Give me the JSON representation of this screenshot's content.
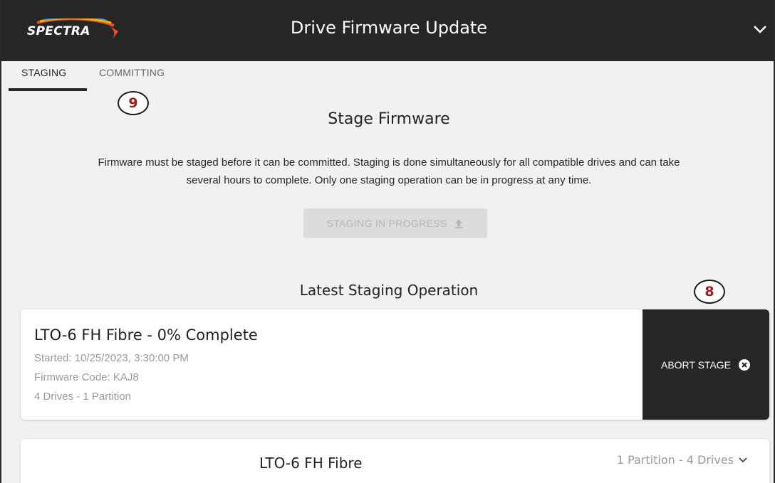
{
  "header": {
    "logo_text": "SPECTRA",
    "title": "Drive Firmware Update",
    "menu_icon": "chevron-down-icon"
  },
  "tabs": [
    {
      "label": "STAGING",
      "active": true
    },
    {
      "label": "COMMITTING",
      "active": false
    }
  ],
  "callouts": {
    "committing": "9",
    "abort": "8"
  },
  "stage": {
    "title": "Stage Firmware",
    "description_line1": "Firmware must be staged before it can be committed. Staging is done simultaneously for all compatible drives and can take",
    "description_line2": "several hours to complete. Only one staging operation can be in progress at any time.",
    "button_label": "STAGING IN PROGRESS",
    "button_icon": "upload-icon",
    "button_disabled": true
  },
  "latest": {
    "title": "Latest Staging Operation",
    "operation_title": "LTO-6 FH Fibre - 0% Complete",
    "started": "Started: 10/25/2023, 3:30:00 PM",
    "firmware_code": "Firmware Code: KAJ8",
    "drives": "4 Drives - 1 Partition",
    "abort_label": "ABORT STAGE",
    "abort_icon": "close-circle-icon"
  },
  "drive_group": {
    "title": "LTO-6 FH Fibre",
    "meta": "1 Partition - 4 Drives",
    "expand_icon": "chevron-down-icon"
  },
  "colors": {
    "header_bg": "#262626",
    "page_bg": "#f1f1f1",
    "callout_text": "#a01c1c",
    "disabled_button_bg": "#dcdcdc"
  }
}
